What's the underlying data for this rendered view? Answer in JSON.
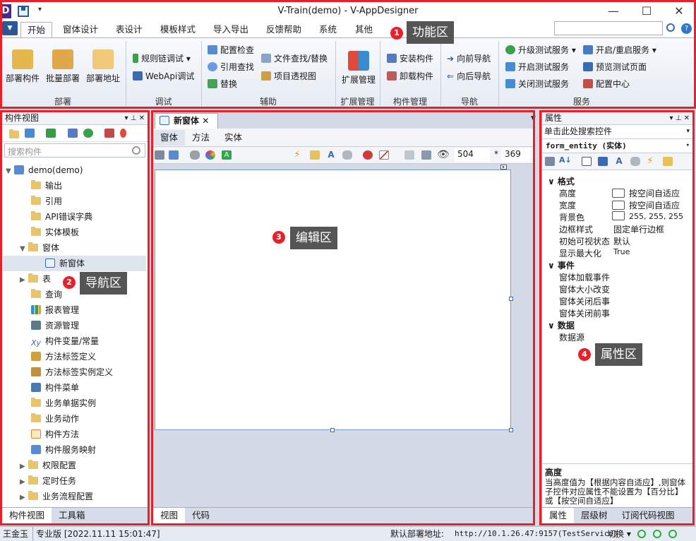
{
  "window": {
    "title": "V-Train(demo) - V-AppDesigner",
    "logo": "D",
    "qa_dropdown": "▾",
    "min": "—",
    "max": "☐",
    "close": "✕"
  },
  "ribbon_tabs": [
    "开始",
    "窗体设计",
    "表设计",
    "模板样式",
    "导入导出",
    "反馈帮助",
    "系统",
    "其他"
  ],
  "groups": {
    "deploy": "部署",
    "debug": "调试",
    "aux": "辅助",
    "ext": "扩展管理",
    "comp": "构件管理",
    "nav": "导航",
    "svc": "服务"
  },
  "deploy": {
    "b1": "部署构件",
    "b2": "批量部署",
    "b3": "部署地址"
  },
  "debug": {
    "b1": "规则链调试",
    "b2": "WebApi调试"
  },
  "aux": {
    "b1": "配置检查",
    "b2": "引用查找",
    "b3": "替换",
    "b4": "文件查找/替换",
    "b5": "项目透视图"
  },
  "ext": {
    "b1": "扩展管理"
  },
  "comp": {
    "b1": "安装构件",
    "b2": "卸载构件"
  },
  "nav": {
    "b1": "向前导航",
    "b2": "向后导航"
  },
  "svc": {
    "b1": "升级测试服务",
    "b2": "开启测试服务",
    "b3": "关闭测试服务",
    "b4": "开启/重启服务",
    "b5": "预览测试页面",
    "b6": "配置中心"
  },
  "left": {
    "title": "构件视图",
    "search_placeholder": "搜索构件",
    "root": "demo(demo)",
    "tabs": [
      "构件视图",
      "工具箱"
    ],
    "items": [
      "输出",
      "引用",
      "API错误字典",
      "实体模板",
      "窗体",
      "新窗体",
      "表",
      "查询",
      "报表管理",
      "资源管理",
      "构件变量/常量",
      "方法标签定义",
      "方法标签实例定义",
      "构件菜单",
      "业务单据实例",
      "业务动作",
      "构件方法",
      "构件服务映射",
      "权限配置",
      "定时任务",
      "业务流程配置"
    ]
  },
  "editor": {
    "doc_tab": "新窗体",
    "sub_tabs": [
      "窗体",
      "方法",
      "实体"
    ],
    "width": "504",
    "times": "*",
    "height": "369",
    "bottom_tabs": [
      "视图",
      "代码"
    ]
  },
  "right": {
    "title": "属性",
    "search_text": "单击此处搜索控件",
    "object": "form_entity (实体)",
    "cat_format": "格式",
    "cat_event": "事件",
    "cat_data": "数据",
    "props": [
      {
        "name": "高度",
        "value": "按空间自适应"
      },
      {
        "name": "宽度",
        "value": "按空间自适应"
      },
      {
        "name": "背景色",
        "value": "255, 255, 255"
      },
      {
        "name": "边框样式",
        "value": "固定单行边框"
      },
      {
        "name": "初始可视状态",
        "value": "默认"
      },
      {
        "name": "显示最大化",
        "value": "True"
      }
    ],
    "events": [
      "窗体加载事件",
      "窗体大小改变",
      "窗体关闭后事",
      "窗体关闭前事"
    ],
    "data": [
      "数据源"
    ],
    "desc_title": "高度",
    "desc_text": "当高度值为【根据内容自适应】,则窗体子控件对应属性不能设置为【百分比】或【按空间自适应】",
    "tabs": [
      "属性",
      "层级树",
      "订阅代码视图"
    ]
  },
  "callouts": [
    {
      "n": "1",
      "label": "功能区"
    },
    {
      "n": "2",
      "label": "导航区"
    },
    {
      "n": "3",
      "label": "编辑区"
    },
    {
      "n": "4",
      "label": "属性区"
    }
  ],
  "status": {
    "user": "王金玉",
    "edition": "专业版 [2022.11.11 15:01:47]",
    "addr_label": "默认部署地址:",
    "addr": "http://10.1.26.47:9157(TestService)",
    "switch": "切换"
  }
}
